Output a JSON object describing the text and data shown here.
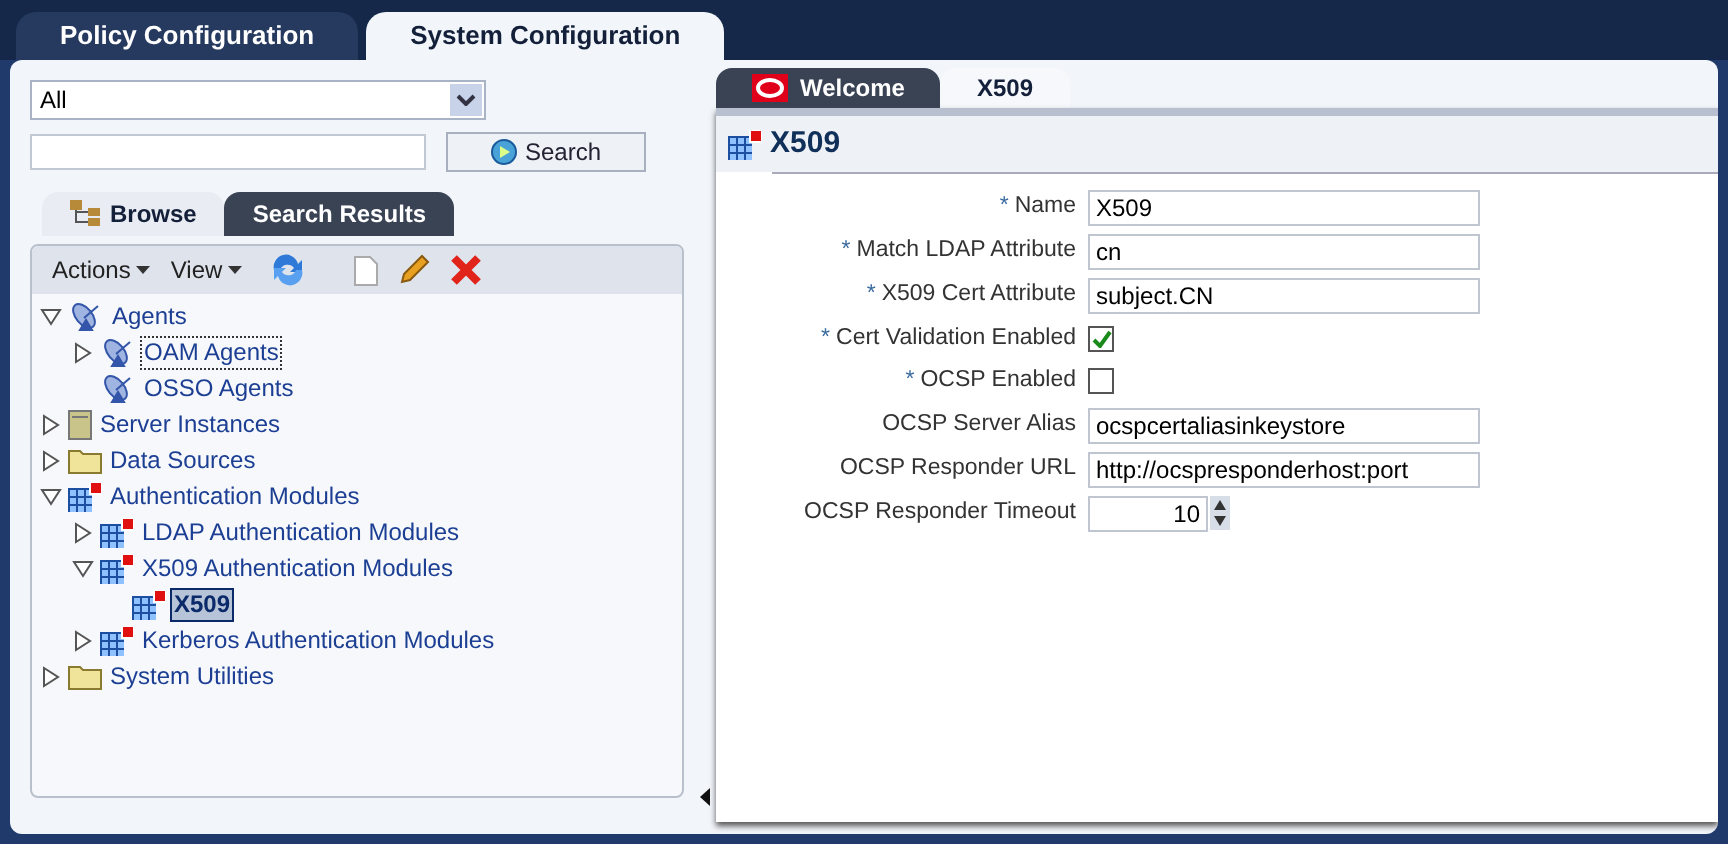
{
  "top_tabs": [
    {
      "label": "Policy Configuration",
      "selected": false
    },
    {
      "label": "System Configuration",
      "selected": true
    }
  ],
  "left": {
    "scope_select": {
      "value": "All"
    },
    "search_button": "Search",
    "panel_tabs": [
      {
        "label": "Browse",
        "selected": true
      },
      {
        "label": "Search Results",
        "selected": false
      }
    ],
    "toolbar": {
      "menus": [
        "Actions",
        "View"
      ]
    },
    "tree": [
      {
        "label": "Agents",
        "kind": "agent",
        "expanded": true,
        "selected": false,
        "focused": false,
        "children": [
          {
            "label": "OAM Agents",
            "kind": "agent",
            "expanded": false,
            "selected": false,
            "focused": true
          },
          {
            "label": "OSSO Agents",
            "kind": "agent",
            "selected": false,
            "focused": false
          }
        ]
      },
      {
        "label": "Server Instances",
        "kind": "server",
        "expanded": false,
        "selected": false,
        "focused": false
      },
      {
        "label": "Data Sources",
        "kind": "folder",
        "expanded": false,
        "selected": false,
        "focused": false
      },
      {
        "label": "Authentication Modules",
        "kind": "module",
        "expanded": true,
        "selected": false,
        "focused": false,
        "children": [
          {
            "label": "LDAP Authentication Modules",
            "kind": "module",
            "expanded": false,
            "selected": false,
            "focused": false
          },
          {
            "label": "X509 Authentication Modules",
            "kind": "module",
            "expanded": true,
            "selected": false,
            "focused": false,
            "children": [
              {
                "label": "X509",
                "kind": "module",
                "selected": true,
                "focused": false
              }
            ]
          },
          {
            "label": "Kerberos Authentication Modules",
            "kind": "module",
            "expanded": false,
            "selected": false,
            "focused": false
          }
        ]
      },
      {
        "label": "System Utilities",
        "kind": "folder",
        "expanded": false,
        "selected": false,
        "focused": false
      }
    ]
  },
  "right": {
    "tabs": [
      {
        "label": "Welcome",
        "selected": false
      },
      {
        "label": "X509",
        "selected": true
      }
    ],
    "title": "X509",
    "fields": [
      {
        "kind": "text",
        "label": "Name",
        "required_mark": "*",
        "value": "X509"
      },
      {
        "kind": "text",
        "label": "Match LDAP Attribute",
        "required_mark": "*",
        "value": "cn"
      },
      {
        "kind": "text",
        "label": "X509 Cert Attribute",
        "required_mark": "*",
        "value": "subject.CN"
      },
      {
        "kind": "checkbox",
        "label": "Cert Validation Enabled",
        "required_mark": "*",
        "checked": true
      },
      {
        "kind": "checkbox",
        "label": "OCSP Enabled",
        "required_mark": "*",
        "checked": false
      },
      {
        "kind": "text",
        "label": "OCSP Server Alias",
        "value": "ocspcertaliasinkeystore"
      },
      {
        "kind": "text",
        "label": "OCSP Responder URL",
        "value": "http://ocspresponderhost:port"
      },
      {
        "kind": "spinner",
        "label": "OCSP Responder Timeout",
        "value": "10"
      }
    ]
  }
}
